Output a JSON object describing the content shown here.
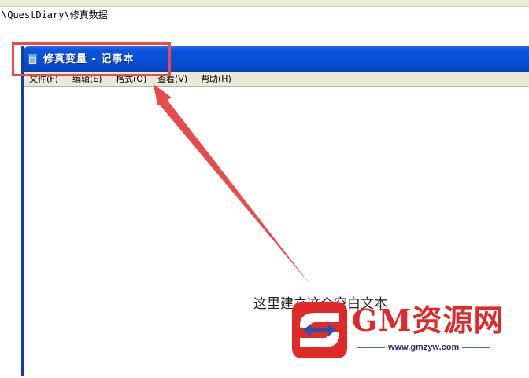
{
  "address_bar": {
    "path": "\\QuestDiary\\修真数据"
  },
  "window": {
    "title": "修真变量 - 记事本",
    "menu": [
      {
        "label": "文件(F)"
      },
      {
        "label": "编辑(E)"
      },
      {
        "label": "格式(O)"
      },
      {
        "label": "查看(V)"
      },
      {
        "label": "帮助(H)"
      }
    ],
    "content": ""
  },
  "annotation": {
    "text": "这里建立这个空白文本",
    "color": "#e84b4b"
  },
  "watermark": {
    "title": "GM资源网",
    "url": "www.gmzyw.com",
    "brand_color": "#e02a2a"
  },
  "colors": {
    "titlebar": "#0a4fd6",
    "menubar": "#ece9d8"
  }
}
